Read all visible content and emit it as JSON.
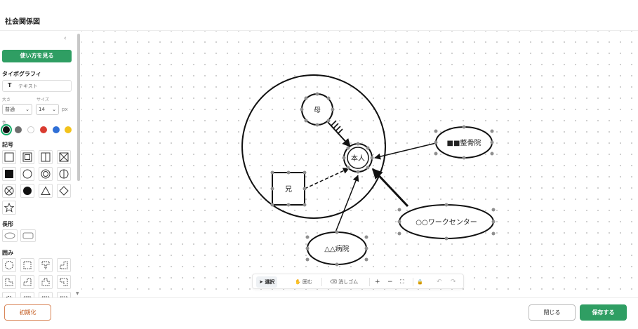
{
  "app": {
    "title": "社会関係図"
  },
  "sidebar": {
    "collapse_icon": "‹",
    "help_button": "使い方を見る",
    "typography": {
      "heading": "タイポグラフィ",
      "text_placeholder": "テキスト",
      "size_label": "大さ",
      "size_value": "普通",
      "fontsize_label": "サイズ",
      "fontsize_value": "14",
      "unit": "px",
      "color_label": "色",
      "colors": [
        "#111111",
        "#6e6e6e",
        "#ffffff",
        "#d93b30",
        "#2f6fd6",
        "#f2c21b"
      ]
    },
    "symbols_heading": "記号",
    "symbols": [
      "square",
      "double-square",
      "split-square",
      "crossed-square",
      "filled-square",
      "circle",
      "double-circle",
      "split-circle",
      "crossed-circle",
      "filled-circle",
      "triangle",
      "diamond",
      "star"
    ],
    "rectangles_heading": "長形",
    "rectangles": [
      "ellipse",
      "rounded-rectangle"
    ],
    "enclosures_heading": "囲み",
    "enclosures": [
      "dashed-circle",
      "dashed-square",
      "dashed-shape-1",
      "dashed-shape-2",
      "dashed-shape-3",
      "dashed-shape-4",
      "dashed-shape-5",
      "dashed-shape-6",
      "dashed-shape-7",
      "dashed-shape-8",
      "dashed-shape-9",
      "dashed-shape-10"
    ]
  },
  "diagram": {
    "nodes": {
      "self": "本人",
      "mother": "母",
      "brother": "兄",
      "clinic": "■■整骨院",
      "work_center": "○○ワークセンター",
      "hospital": "△△病院"
    }
  },
  "toolbar": {
    "select": "選択",
    "enclose": "囲む",
    "eraser": "消しゴム",
    "zoom_in": "+",
    "zoom_out": "−",
    "fit": "⛶",
    "lock": "🔒",
    "undo": "↶",
    "redo": "↷"
  },
  "footer": {
    "reset": "初期化",
    "close": "閉じる",
    "save": "保存する"
  }
}
